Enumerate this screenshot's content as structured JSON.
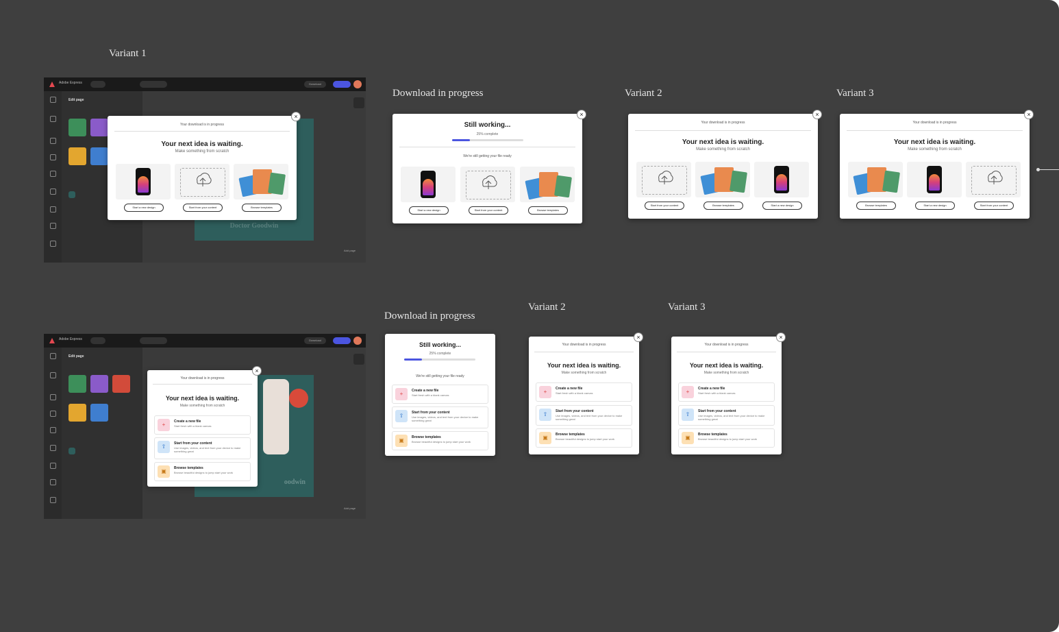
{
  "labels": {
    "variant1": "Variant 1",
    "download_top": "Download in progress",
    "variant2_top": "Variant 2",
    "variant3_top": "Variant 3",
    "download_bottom": "Download in progress",
    "variant2_bottom": "Variant 2",
    "variant3_bottom": "Variant 3"
  },
  "app": {
    "name": "Adobe Express",
    "panel_title": "Edit page",
    "download": "Download",
    "share": "Share",
    "add_page": "Add page",
    "artwork_text": "Doctor Goodwin",
    "artwork_text_bottom": "oodwin"
  },
  "modal": {
    "kicker": "Your download is in progress",
    "heading": "Your next idea is waiting.",
    "subheading": "Make something from scratch",
    "still_working": "Still working...",
    "percent_complete": "25% complete",
    "still_working_sub": "We're still getting your file ready",
    "options": {
      "new_design": "Start a new design",
      "from_content": "Start from your content",
      "templates": "Browse templates"
    },
    "rows": {
      "new_file_title": "Create a new file",
      "new_file_desc": "Start fresh with a blank canvas",
      "content_title": "Start from your content",
      "content_desc": "Use images, videos, and text from your device to make something great",
      "templates_title": "Browse templates",
      "templates_desc": "Browse beautiful designs to jump start your work"
    }
  },
  "colors": {
    "canvas": "#3f3f3f",
    "accent": "#4b55e0",
    "pink": "#f9d2dc",
    "blue": "#cfe4f8",
    "orange": "#fde0b4"
  }
}
